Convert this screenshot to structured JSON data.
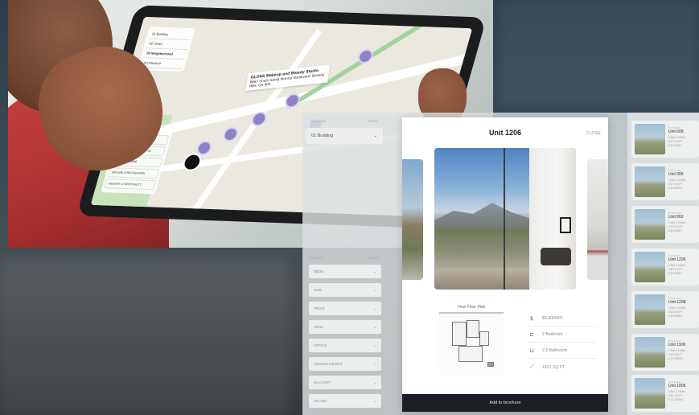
{
  "tablet": {
    "menu_top": [
      "01 Building",
      "02 Views",
      "03 Neighborhood",
      "Architecture"
    ],
    "popup_title": "GLOSS Makeup and Beauty Studio",
    "popup_address": "9867 South Santa Monica Boulevard, Beverly Hills, CA 902...",
    "menu_bottom": [
      "GROCERIES & CULINARY",
      "SHOPPING & LIFESTYLE",
      "ART & CULTURE",
      "NATURE & RECREATION",
      "RESORT & HOSPITALITY"
    ]
  },
  "left_panel": {
    "building_header_left": "BUILDING",
    "building_header_right": "RESET",
    "building_value": "01 Building",
    "filters_header_left": "FILTERS",
    "filters_header_right": "RESET",
    "filters": [
      "BEDS",
      "SIZE",
      "PRICE",
      "VIEW",
      "OFFICE",
      "CEILING HEIGHT",
      "BALCONY",
      "ISLAND"
    ]
  },
  "modal": {
    "title": "Unit 1206",
    "close_label": "CLOSE",
    "floor_plan_link": "View Floor Plan",
    "specs": [
      {
        "icon": "dollar-icon",
        "glyph": "$",
        "label": "$9,900/MO"
      },
      {
        "icon": "bed-icon",
        "glyph": "⊏",
        "label": "2 Bedroom"
      },
      {
        "icon": "bath-icon",
        "glyph": "⊔",
        "label": "2.5 Bathroom"
      },
      {
        "icon": "ruler-icon",
        "glyph": "⟋",
        "label": "1621 SQ FT."
      }
    ],
    "cta_label": "Add to brochure"
  },
  "unit_list": [
    {
      "name": "Unit 608",
      "meta": [
        "1 Bed 1.5 Bath",
        "1077 SQ FT",
        "$ 4,800/MO"
      ]
    },
    {
      "name": "Unit 906",
      "meta": [
        "1 Bed 1.5 Bath",
        "1077 SQ FT",
        "$ 5,300/MO"
      ]
    },
    {
      "name": "Unit 802",
      "meta": [
        "2 Bed 1.5 Bath",
        "1078 SQ FT",
        "$ 8,600/MO"
      ]
    },
    {
      "name": "Unit 1206",
      "meta": [
        "2 Bed 2.5 Bath",
        "1621 SQ FT",
        "$ 9,900/MO"
      ]
    },
    {
      "name": "Unit 1208",
      "meta": [
        "2 Bed 2.5 Bath",
        "1621 SQ FT",
        "$ 9,500/MO"
      ]
    },
    {
      "name": "Unit 1906",
      "meta": [
        "2 Bed 2.5 Bath",
        "1621 SQ FT",
        "$ 12,500/MO"
      ]
    },
    {
      "name": "Unit 1806",
      "meta": [
        "2 Bed 2.5 Bath",
        "1621 SQ FT",
        "$ 12,200/MO"
      ]
    }
  ]
}
